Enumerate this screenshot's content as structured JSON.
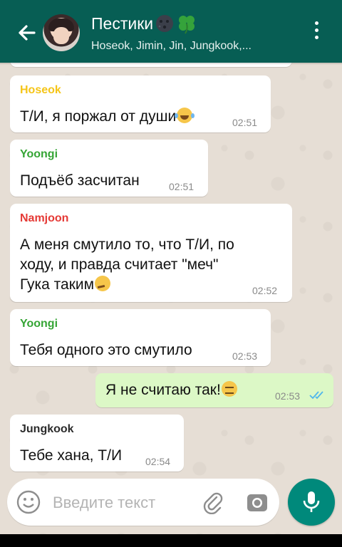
{
  "header": {
    "title": "Пестики",
    "title_emojis": [
      "new-moon-face-icon",
      "four-leaf-clover-icon"
    ],
    "subtitle": "Hoseok, Jimin, Jin, Jungkook,..."
  },
  "messages": [
    {
      "sender": "Hoseok",
      "sender_color": "#f5c518",
      "lines": [
        "Т/И, я поржал от души"
      ],
      "emoji": "laughing-tears-emoji",
      "time": "02:51",
      "outgoing": false
    },
    {
      "sender": "Yoongi",
      "sender_color": "#35a535",
      "lines": [
        "Подъёб засчитан"
      ],
      "time": "02:51",
      "outgoing": false
    },
    {
      "sender": "Namjoon",
      "sender_color": "#e53935",
      "lines": [
        "А меня смутило то, что Т/И, по",
        "ходу, и правда считает \"меч\"",
        "Гука таким"
      ],
      "emoji": "thinking-face-emoji",
      "time": "02:52",
      "outgoing": false
    },
    {
      "sender": "Yoongi",
      "sender_color": "#35a535",
      "lines": [
        "Тебя одного это смутило"
      ],
      "time": "02:53",
      "outgoing": false
    },
    {
      "lines": [
        "Я не считаю так!"
      ],
      "emoji": "expressionless-face-emoji",
      "time": "02:53",
      "status": "read-double-check",
      "outgoing": true
    },
    {
      "sender": "Jungkook",
      "sender_color": "#2b2b2b",
      "lines": [
        "Тебе хана, Т/И"
      ],
      "time": "02:54",
      "outgoing": false
    }
  ],
  "composer": {
    "placeholder": "Введите текст"
  },
  "colors": {
    "header": "#075e54",
    "outgoing_bubble": "#dcf8c6",
    "mic_button": "#00897b",
    "read_ticks": "#4fb6ec"
  }
}
